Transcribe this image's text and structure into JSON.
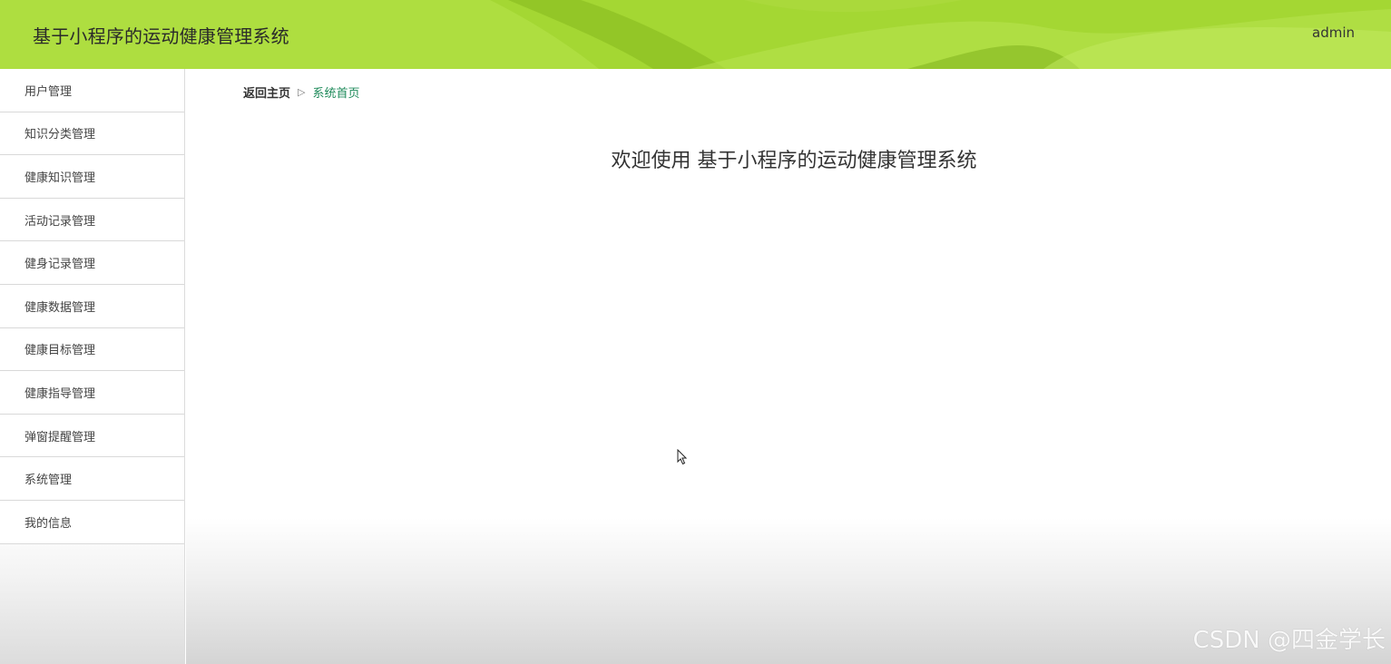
{
  "header": {
    "app_title": "基于小程序的运动健康管理系统",
    "user": "admin"
  },
  "sidebar": {
    "items": [
      {
        "label": "用户管理"
      },
      {
        "label": "知识分类管理"
      },
      {
        "label": "健康知识管理"
      },
      {
        "label": "活动记录管理"
      },
      {
        "label": "健身记录管理"
      },
      {
        "label": "健康数据管理"
      },
      {
        "label": "健康目标管理"
      },
      {
        "label": "健康指导管理"
      },
      {
        "label": "弹窗提醒管理"
      },
      {
        "label": "系统管理"
      },
      {
        "label": "我的信息"
      }
    ]
  },
  "breadcrumb": {
    "home": "返回主页",
    "separator": "▷",
    "current": "系统首页"
  },
  "main": {
    "welcome": "欢迎使用 基于小程序的运动健康管理系统"
  },
  "watermark": "CSDN @四金学长",
  "colors": {
    "header_bg": "#a4d733",
    "breadcrumb_active": "#1e8a5a"
  }
}
